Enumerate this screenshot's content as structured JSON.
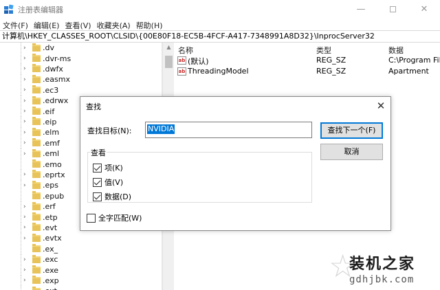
{
  "window": {
    "title": "注册表编辑器",
    "controls": {
      "minimize": "—",
      "close": "✕"
    }
  },
  "menu": [
    "文件(F)",
    "编辑(E)",
    "查看(V)",
    "收藏夹(A)",
    "帮助(H)"
  ],
  "address": "计算机\\HKEY_CLASSES_ROOT\\CLSID\\{00E80F18-EC5B-4FCF-A417-7348991A8D32}\\InprocServer32",
  "tree": {
    "items": [
      ".dv",
      ".dvr-ms",
      ".dwfx",
      ".easmx",
      ".ec3",
      ".edrwx",
      ".eif",
      ".eip",
      ".elm",
      ".emf",
      ".eml",
      ".emo",
      ".eprtx",
      ".eps",
      ".epub",
      ".erf",
      ".etp",
      ".evt",
      ".evtx",
      ".ex_",
      ".exc",
      ".exe",
      ".exp",
      ".ext"
    ],
    "collapsed_items": [
      ".emo",
      ".epub",
      ".ex_",
      ".ext"
    ]
  },
  "values_table": {
    "headers": {
      "name": "名称",
      "type": "类型",
      "data": "数据"
    },
    "rows": [
      {
        "name": "(默认)",
        "type": "REG_SZ",
        "data": "C:\\Program File"
      },
      {
        "name": "ThreadingModel",
        "type": "REG_SZ",
        "data": "Apartment"
      }
    ]
  },
  "find_dialog": {
    "title": "查找",
    "close": "✕",
    "find_label": "查找目标(N):",
    "find_value": "NVIDIA",
    "find_next": "查找下一个(F)",
    "cancel": "取消",
    "look_at": "查看",
    "options": [
      {
        "label": "项(K)",
        "checked": true
      },
      {
        "label": "值(V)",
        "checked": true
      },
      {
        "label": "数据(D)",
        "checked": true
      }
    ],
    "match_whole": {
      "label": "全字匹配(W)",
      "checked": false
    }
  },
  "watermark": {
    "title": "装机之家",
    "url": "gdhjbk.com"
  },
  "colors": {
    "accent": "#0078d7",
    "folder": "#e8c35a"
  }
}
